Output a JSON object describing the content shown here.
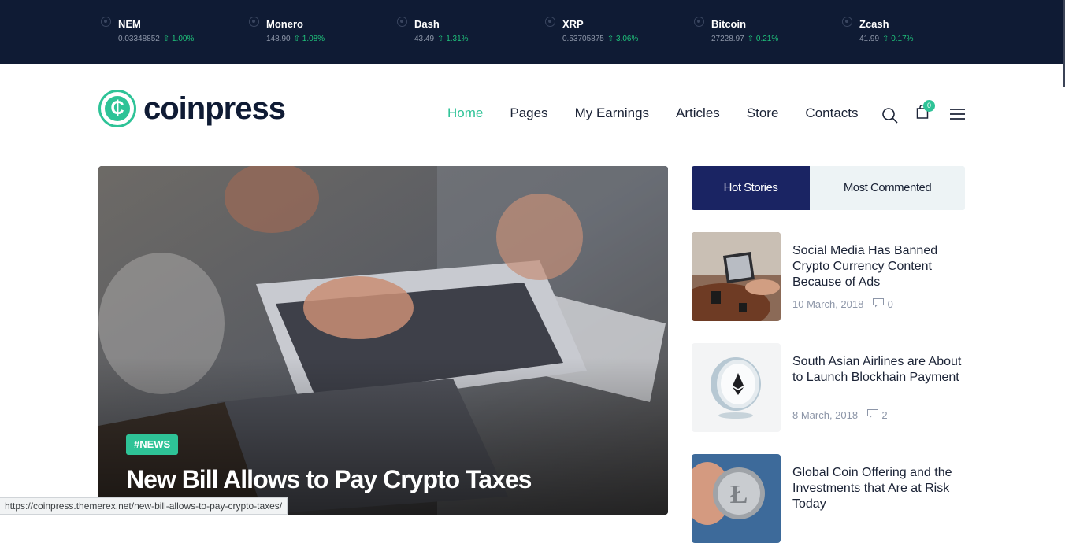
{
  "ticker": [
    {
      "name": "NEM",
      "price": "0.03348852",
      "change": "⇧ 1.00%"
    },
    {
      "name": "Monero",
      "price": "148.90",
      "change": "⇧ 1.08%"
    },
    {
      "name": "Dash",
      "price": "43.49",
      "change": "⇧ 1.31%"
    },
    {
      "name": "XRP",
      "price": "0.53705875",
      "change": "⇧ 3.06%"
    },
    {
      "name": "Bitcoin",
      "price": "27228.97",
      "change": "⇧ 0.21%"
    },
    {
      "name": "Zcash",
      "price": "41.99",
      "change": "⇧ 0.17%"
    }
  ],
  "logo": {
    "text": "coinpress",
    "mark": "₵"
  },
  "nav": [
    "Home",
    "Pages",
    "My Earnings",
    "Articles",
    "Store",
    "Contacts"
  ],
  "cart": {
    "count": "0"
  },
  "hero": {
    "tag": "#NEWS",
    "title": "New Bill Allows to Pay Crypto Taxes"
  },
  "tabs": {
    "hot": "Hot Stories",
    "most": "Most Commented"
  },
  "stories": [
    {
      "title": "Social Media Has Banned Crypto Currency Content Because of Ads",
      "date": "10 March, 2018",
      "comments": "0"
    },
    {
      "title": "South Asian Airlines are About to Launch Blockhain Payment",
      "date": "8 March, 2018",
      "comments": "2"
    },
    {
      "title": "Global Coin Offering and the Investments that Are at Risk Today",
      "date": "",
      "comments": ""
    }
  ],
  "status_url": "https://coinpress.themerex.net/new-bill-allows-to-pay-crypto-taxes/",
  "colors": {
    "accent": "#2ec397",
    "dark": "#0f1b34",
    "navy": "#1a2463"
  }
}
